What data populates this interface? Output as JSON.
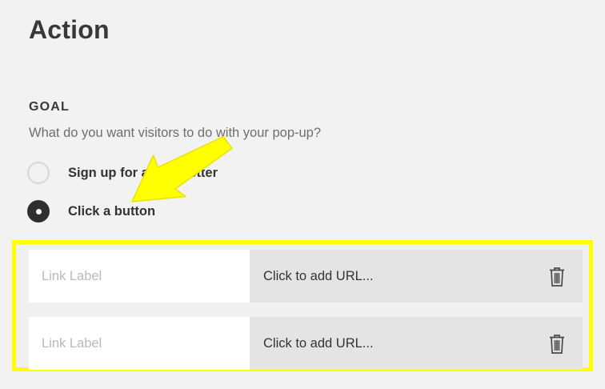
{
  "page": {
    "title": "Action"
  },
  "goal": {
    "heading": "GOAL",
    "description": "What do you want visitors to do with your pop-up?",
    "options": [
      {
        "label": "Sign up for a newsletter",
        "selected": false
      },
      {
        "label": "Click a button",
        "selected": true
      }
    ]
  },
  "links": [
    {
      "label_placeholder": "Link Label",
      "url_text": "Click to add URL...",
      "delete_icon": "trash-icon"
    },
    {
      "label_placeholder": "Link Label",
      "url_text": "Click to add URL...",
      "delete_icon": "trash-icon"
    }
  ],
  "colors": {
    "background": "#f2f2f2",
    "highlight": "#ffff00",
    "arrow": "#ffff00",
    "url_field": "#e4e4e4",
    "radio_selected": "#2f2f2f"
  }
}
